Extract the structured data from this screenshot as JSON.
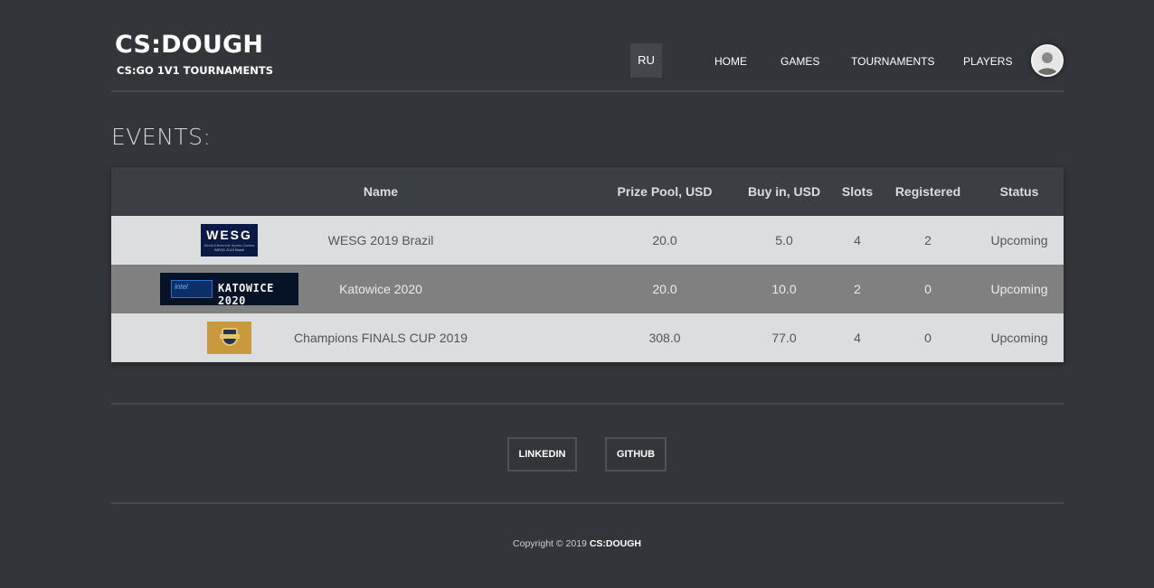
{
  "brand": {
    "title": "CS:DOUGH",
    "subtitle": "CS:GO 1V1 TOURNAMENTS"
  },
  "header": {
    "lang_button": "RU",
    "nav": [
      "HOME",
      "GAMES",
      "TOURNAMENTS",
      "PLAYERS"
    ],
    "avatar_icon": "user-avatar-icon"
  },
  "events": {
    "title": "EVENTS:",
    "columns": [
      "Name",
      "Prize Pool, USD",
      "Buy in, USD",
      "Slots",
      "Registered",
      "Status"
    ],
    "rows": [
      {
        "logo_text": "WESG",
        "logo_sub1": "World Electronic Sports Games",
        "logo_sub2": "WESG 2019 Brazil",
        "name": "WESG 2019 Brazil",
        "prize": "20.0",
        "buyin": "5.0",
        "slots": "4",
        "registered": "2",
        "status": "Upcoming"
      },
      {
        "logo_text": "KATOWICE 2020",
        "logo_badge": "intel",
        "name": "Katowice 2020",
        "prize": "20.0",
        "buyin": "10.0",
        "slots": "2",
        "registered": "0",
        "status": "Upcoming"
      },
      {
        "name": "Champions FINALS CUP 2019",
        "prize": "308.0",
        "buyin": "77.0",
        "slots": "4",
        "registered": "0",
        "status": "Upcoming"
      }
    ]
  },
  "footer": {
    "links": [
      "LINKEDIN",
      "GITHUB"
    ],
    "copyright_prefix": "Copyright © 2019",
    "copyright_brand": "CS:DOUGH"
  },
  "colors": {
    "background": "#32353a",
    "header_row": "#3b3e43",
    "row_light": "#dcdddf",
    "row_dark": "#808080"
  }
}
